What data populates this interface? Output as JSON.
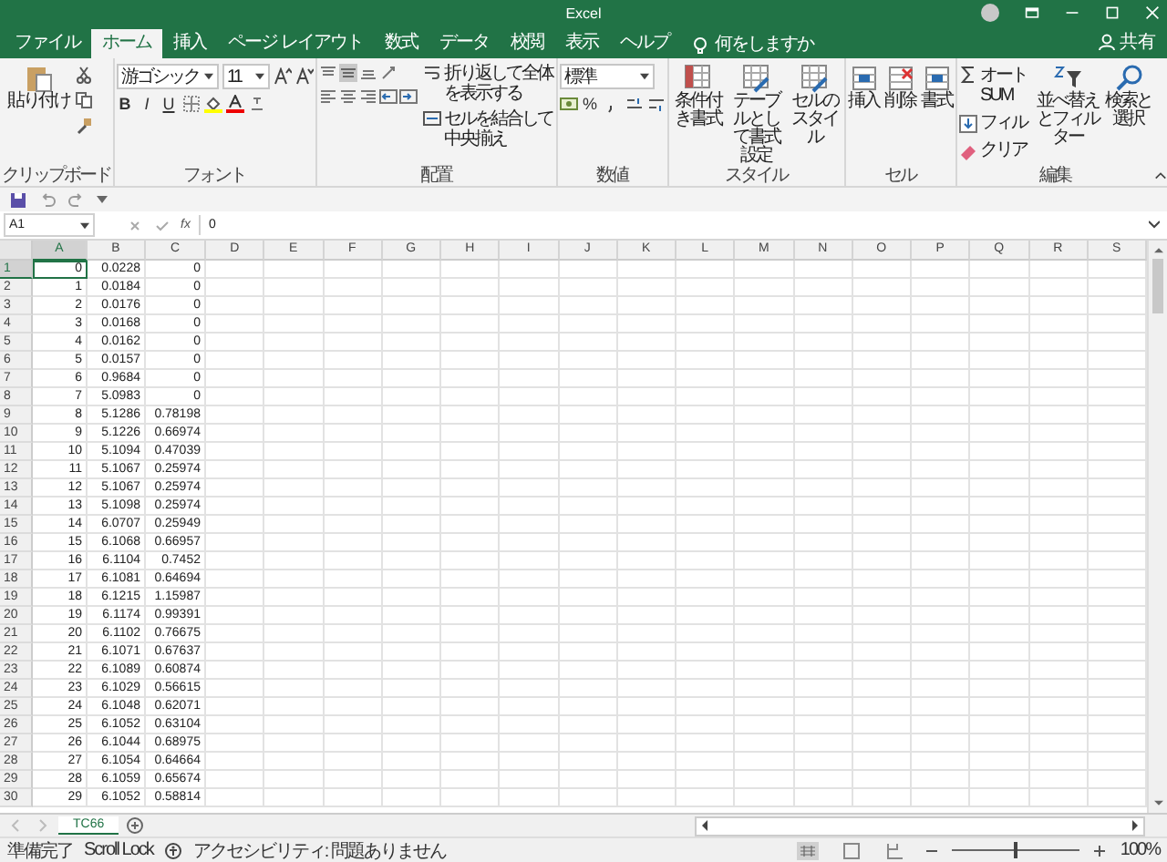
{
  "title_bar": {
    "title": "Excel",
    "share": "共有"
  },
  "tabs": [
    {
      "label": "ファイル",
      "selected": false
    },
    {
      "label": "ホーム",
      "selected": true
    },
    {
      "label": "挿入",
      "selected": false
    },
    {
      "label": "ページ レイアウト",
      "selected": false
    },
    {
      "label": "数式",
      "selected": false
    },
    {
      "label": "データ",
      "selected": false
    },
    {
      "label": "校閲",
      "selected": false
    },
    {
      "label": "表示",
      "selected": false
    },
    {
      "label": "ヘルプ",
      "selected": false
    }
  ],
  "tell_me": {
    "placeholder": "何をしますか"
  },
  "ribbon": {
    "clipboard": {
      "paste": "貼り付け",
      "label": "クリップボード"
    },
    "font": {
      "font_name": "游ゴシック",
      "font_size": "11",
      "bold": "B",
      "italic": "I",
      "underline": "U",
      "label": "フォント"
    },
    "alignment": {
      "wrap_text": "折り返して全体を表示する",
      "merge_center": "セルを結合して中央揃え",
      "label": "配置"
    },
    "number": {
      "format": "標準",
      "percent": "%",
      "label": "数値"
    },
    "styles": {
      "buttons": [
        "条件付き書式",
        "テーブルとして書式設定",
        "セルのスタイル"
      ],
      "label": "スタイル"
    },
    "cells": {
      "buttons": [
        "挿入",
        "削除",
        "書式"
      ],
      "label": "セル"
    },
    "editing": {
      "autosum": "オート SUM",
      "fill": "フィル",
      "clear": "クリア",
      "sort_filter": "並べ替えとフィルター",
      "find_select": "検索と選択",
      "label": "編集"
    }
  },
  "formula_bar": {
    "name_box": "A1",
    "fx": "fx",
    "value": "0"
  },
  "columns": [
    {
      "label": "A",
      "selected": true
    },
    {
      "label": "B",
      "selected": false
    },
    {
      "label": "C",
      "selected": false
    },
    {
      "label": "D",
      "selected": false
    },
    {
      "label": "E",
      "selected": false
    },
    {
      "label": "F",
      "selected": false
    },
    {
      "label": "G",
      "selected": false
    },
    {
      "label": "H",
      "selected": false
    },
    {
      "label": "I",
      "selected": false
    },
    {
      "label": "J",
      "selected": false
    },
    {
      "label": "K",
      "selected": false
    },
    {
      "label": "L",
      "selected": false
    },
    {
      "label": "M",
      "selected": false
    },
    {
      "label": "N",
      "selected": false
    },
    {
      "label": "O",
      "selected": false
    },
    {
      "label": "P",
      "selected": false
    },
    {
      "label": "Q",
      "selected": false
    },
    {
      "label": "R",
      "selected": false
    },
    {
      "label": "S",
      "selected": false
    }
  ],
  "rows": [
    {
      "header": "1",
      "selected": true,
      "cells": [
        "0",
        "0.0228",
        "0"
      ]
    },
    {
      "header": "2",
      "selected": false,
      "cells": [
        "1",
        "0.0184",
        "0"
      ]
    },
    {
      "header": "3",
      "selected": false,
      "cells": [
        "2",
        "0.0176",
        "0"
      ]
    },
    {
      "header": "4",
      "selected": false,
      "cells": [
        "3",
        "0.0168",
        "0"
      ]
    },
    {
      "header": "5",
      "selected": false,
      "cells": [
        "4",
        "0.0162",
        "0"
      ]
    },
    {
      "header": "6",
      "selected": false,
      "cells": [
        "5",
        "0.0157",
        "0"
      ]
    },
    {
      "header": "7",
      "selected": false,
      "cells": [
        "6",
        "0.9684",
        "0"
      ]
    },
    {
      "header": "8",
      "selected": false,
      "cells": [
        "7",
        "5.0983",
        "0"
      ]
    },
    {
      "header": "9",
      "selected": false,
      "cells": [
        "8",
        "5.1286",
        "0.78198"
      ]
    },
    {
      "header": "10",
      "selected": false,
      "cells": [
        "9",
        "5.1226",
        "0.66974"
      ]
    },
    {
      "header": "11",
      "selected": false,
      "cells": [
        "10",
        "5.1094",
        "0.47039"
      ]
    },
    {
      "header": "12",
      "selected": false,
      "cells": [
        "11",
        "5.1067",
        "0.25974"
      ]
    },
    {
      "header": "13",
      "selected": false,
      "cells": [
        "12",
        "5.1067",
        "0.25974"
      ]
    },
    {
      "header": "14",
      "selected": false,
      "cells": [
        "13",
        "5.1098",
        "0.25974"
      ]
    },
    {
      "header": "15",
      "selected": false,
      "cells": [
        "14",
        "6.0707",
        "0.25949"
      ]
    },
    {
      "header": "16",
      "selected": false,
      "cells": [
        "15",
        "6.1068",
        "0.66957"
      ]
    },
    {
      "header": "17",
      "selected": false,
      "cells": [
        "16",
        "6.1104",
        "0.7452"
      ]
    },
    {
      "header": "18",
      "selected": false,
      "cells": [
        "17",
        "6.1081",
        "0.64694"
      ]
    },
    {
      "header": "19",
      "selected": false,
      "cells": [
        "18",
        "6.1215",
        "1.15987"
      ]
    },
    {
      "header": "20",
      "selected": false,
      "cells": [
        "19",
        "6.1174",
        "0.99391"
      ]
    },
    {
      "header": "21",
      "selected": false,
      "cells": [
        "20",
        "6.1102",
        "0.76675"
      ]
    },
    {
      "header": "22",
      "selected": false,
      "cells": [
        "21",
        "6.1071",
        "0.67637"
      ]
    },
    {
      "header": "23",
      "selected": false,
      "cells": [
        "22",
        "6.1089",
        "0.60874"
      ]
    },
    {
      "header": "24",
      "selected": false,
      "cells": [
        "23",
        "6.1029",
        "0.56615"
      ]
    },
    {
      "header": "25",
      "selected": false,
      "cells": [
        "24",
        "6.1048",
        "0.62071"
      ]
    },
    {
      "header": "26",
      "selected": false,
      "cells": [
        "25",
        "6.1052",
        "0.63104"
      ]
    },
    {
      "header": "27",
      "selected": false,
      "cells": [
        "26",
        "6.1044",
        "0.68975"
      ]
    },
    {
      "header": "28",
      "selected": false,
      "cells": [
        "27",
        "6.1054",
        "0.64664"
      ]
    },
    {
      "header": "29",
      "selected": false,
      "cells": [
        "28",
        "6.1059",
        "0.65674"
      ]
    },
    {
      "header": "30",
      "selected": false,
      "cells": [
        "29",
        "6.1052",
        "0.58814"
      ]
    }
  ],
  "sheet_tabs": [
    {
      "label": "TC66",
      "selected": true
    }
  ],
  "status_bar": {
    "ready": "準備完了",
    "scroll_lock": "Scroll Lock",
    "accessibility": "アクセシビリティ: 問題ありません",
    "zoom_slider": {
      "level": 0.5
    },
    "zoom": "100%"
  }
}
